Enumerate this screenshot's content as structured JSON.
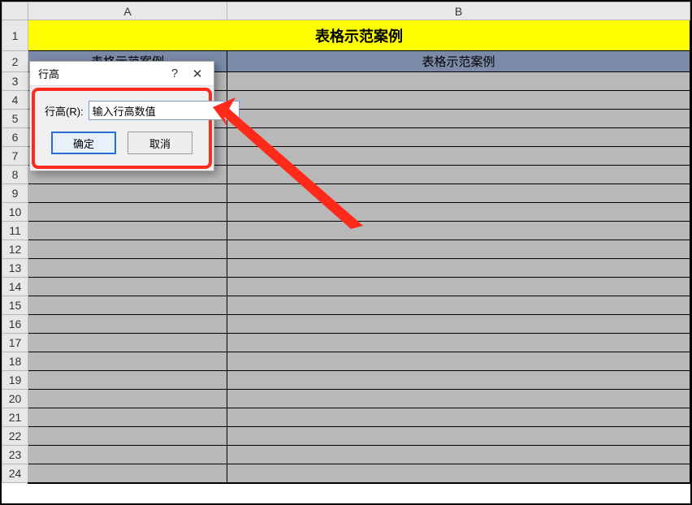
{
  "columns": [
    "A",
    "B"
  ],
  "rows": [
    "1",
    "2",
    "3",
    "4",
    "5",
    "6",
    "7",
    "8",
    "9",
    "10",
    "11",
    "12",
    "13",
    "14",
    "15",
    "16",
    "17",
    "18",
    "19",
    "20",
    "21",
    "22",
    "23",
    "24"
  ],
  "merged_title": "表格示范案例",
  "row2": {
    "A": "表格示范案例",
    "B": "表格示范案例"
  },
  "dialog": {
    "title": "行高",
    "help_tooltip": "?",
    "close_tooltip": "✕",
    "field_label": "行高(R):",
    "field_value": "输入行高数值",
    "ok_label": "确定",
    "cancel_label": "取消"
  },
  "annotation": {
    "color": "#ff2a1a"
  }
}
